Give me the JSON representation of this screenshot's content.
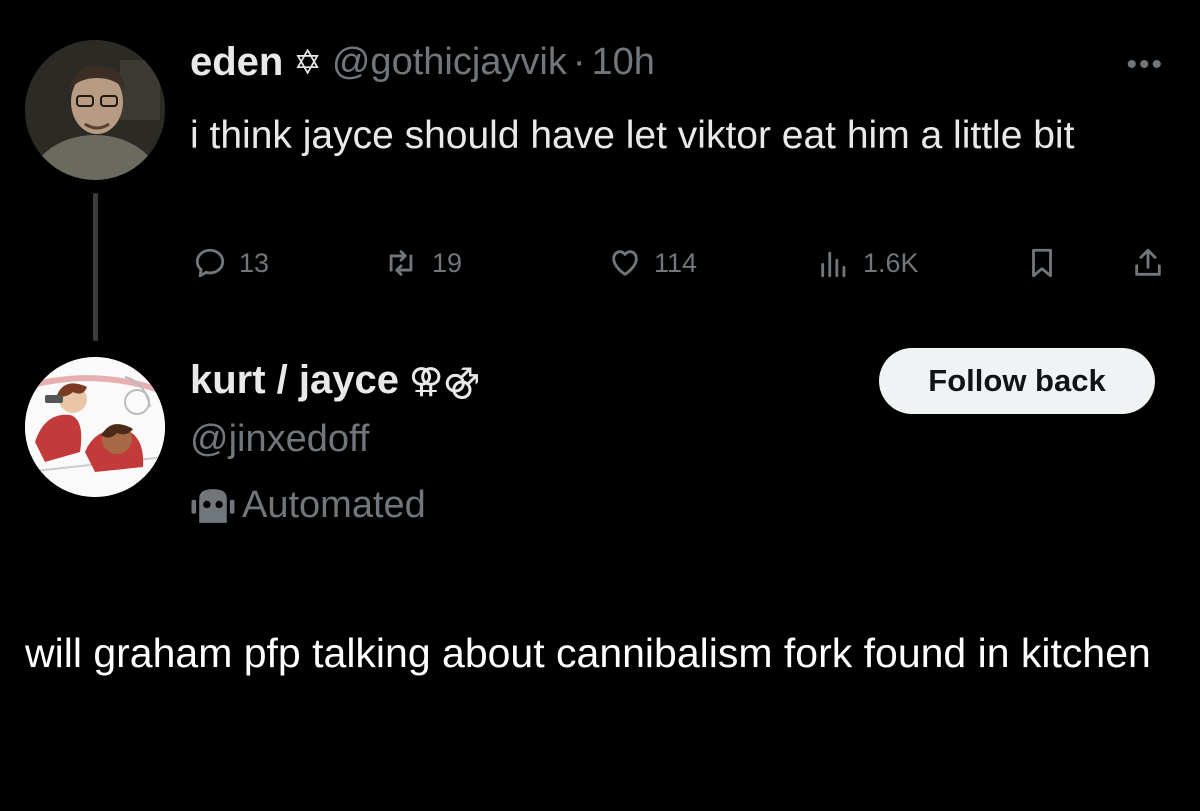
{
  "tweet": {
    "author_name": "eden",
    "author_badge": "✡",
    "author_handle": "@gothicjayvik",
    "separator": "·",
    "time": "10h",
    "text": "i think jayce should have let viktor eat him a little bit",
    "replies": "13",
    "retweets": "19",
    "likes": "114",
    "views": "1.6K",
    "icons": [
      "reply-icon",
      "retweet-icon",
      "like-icon",
      "views-icon",
      "bookmark-icon",
      "share-icon",
      "more-icon"
    ]
  },
  "profile": {
    "name": "kurt / jayce",
    "badge": "⚢⚣",
    "handle": "@jinxedoff",
    "follow_label": "Follow back",
    "automated_label": "Automated"
  },
  "caption": "will graham pfp talking about cannibalism fork found in kitchen",
  "colors": {
    "background": "#000000",
    "text": "#e7e9ea",
    "muted": "#71767b",
    "button_bg": "#eff3f4"
  }
}
